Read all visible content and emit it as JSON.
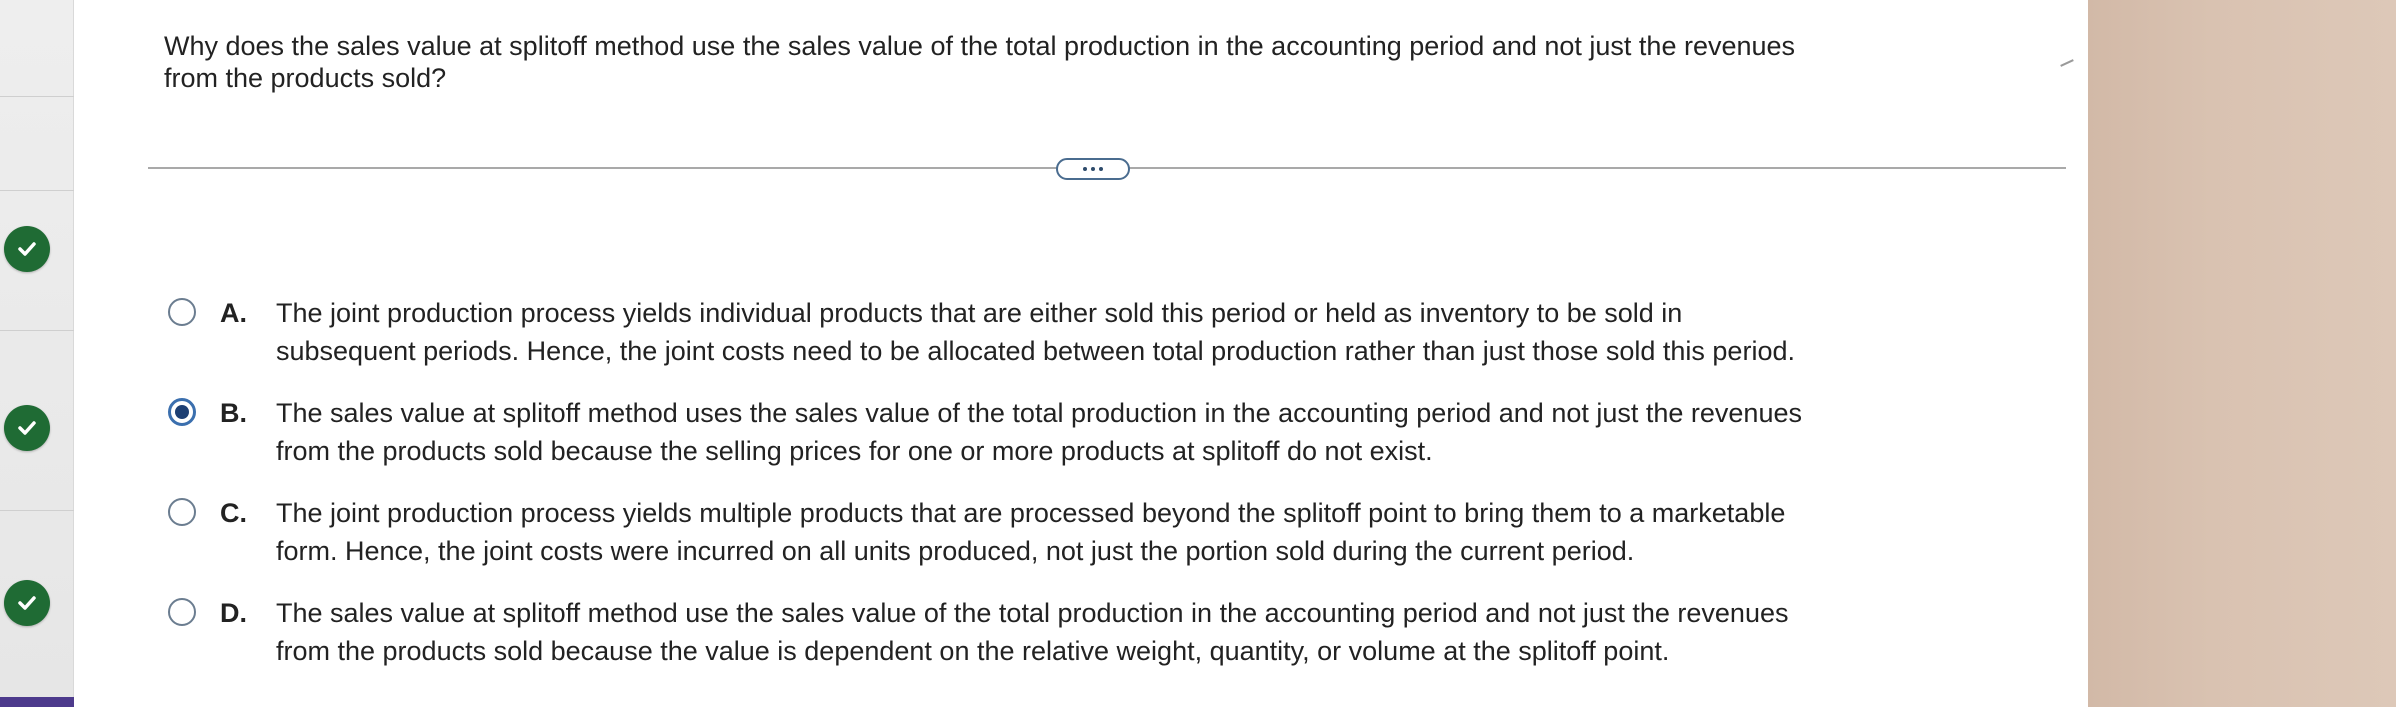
{
  "question": {
    "text_line1": "Why does the sales value at splitoff method use the sales value of the total production in the accounting period and not just the revenues",
    "text_line2": "from the products sold?"
  },
  "more_button": {
    "icon": "ellipsis-icon"
  },
  "left_rail": {
    "status_icons": [
      "check-icon",
      "check-icon",
      "check-icon"
    ],
    "status_color": "#1f6b34"
  },
  "options": [
    {
      "letter": "A.",
      "line1": "The joint production process yields individual products that are either sold this period or held as inventory to be sold in",
      "line2": "subsequent periods. Hence, the joint costs need to be allocated between total production rather than just those sold this period.",
      "selected": false
    },
    {
      "letter": "B.",
      "line1": "The sales value at splitoff method uses the sales value of the total production in the accounting period and not just the revenues",
      "line2": "from the products sold because the selling prices for one or more products at splitoff do not exist.",
      "selected": true
    },
    {
      "letter": "C.",
      "line1": "The joint production process yields multiple products that are processed beyond the splitoff point to bring them to a marketable",
      "line2": "form. Hence, the joint costs were incurred on all units produced, not just the portion sold during the current period.",
      "selected": false
    },
    {
      "letter": "D.",
      "line1": "The sales value at splitoff method use the sales value of the total production in the accounting period and not just the revenues",
      "line2": "from the products sold because the value is dependent on the relative weight, quantity, or volume at the splitoff point.",
      "selected": false
    }
  ],
  "colors": {
    "radio_selected": "#1d3f73",
    "accent_bar": "#4d3a8c"
  }
}
